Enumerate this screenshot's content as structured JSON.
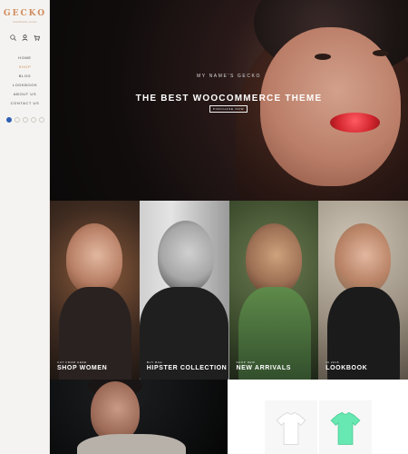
{
  "sidebar": {
    "logo": "GECKO",
    "tagline": "handmade stores",
    "menu": [
      {
        "label": "HOME",
        "active": false
      },
      {
        "label": "SHOP",
        "active": true
      },
      {
        "label": "BLOG",
        "active": false
      },
      {
        "label": "LOOKBOOK",
        "active": false
      },
      {
        "label": "ABOUT US",
        "active": false
      },
      {
        "label": "CONTACT US",
        "active": false
      }
    ]
  },
  "hero": {
    "kicker": "MY NAME'S GECKO",
    "title": "THE BEST WOOCOMMERCE THEME",
    "cta": "PURCHASE NOW"
  },
  "categories": [
    {
      "kicker": "CUT FROM HERE",
      "title": "SHOP WOMEN",
      "accent": "#6b3f2a"
    },
    {
      "kicker": "BUY BAG",
      "title": "HIPSTER COLLECTION",
      "accent": "#3d3d3d"
    },
    {
      "kicker": "SHOP NEW",
      "title": "NEW ARRIVALS",
      "accent": "#2f4a2a"
    },
    {
      "kicker": "IN 2018",
      "title": "LOOKBOOK",
      "accent": "#7a6b55"
    }
  ],
  "colors": {
    "brand_accent": "#d08b5b",
    "tee_white": "#ffffff",
    "tee_mint": "#67e7b2"
  }
}
